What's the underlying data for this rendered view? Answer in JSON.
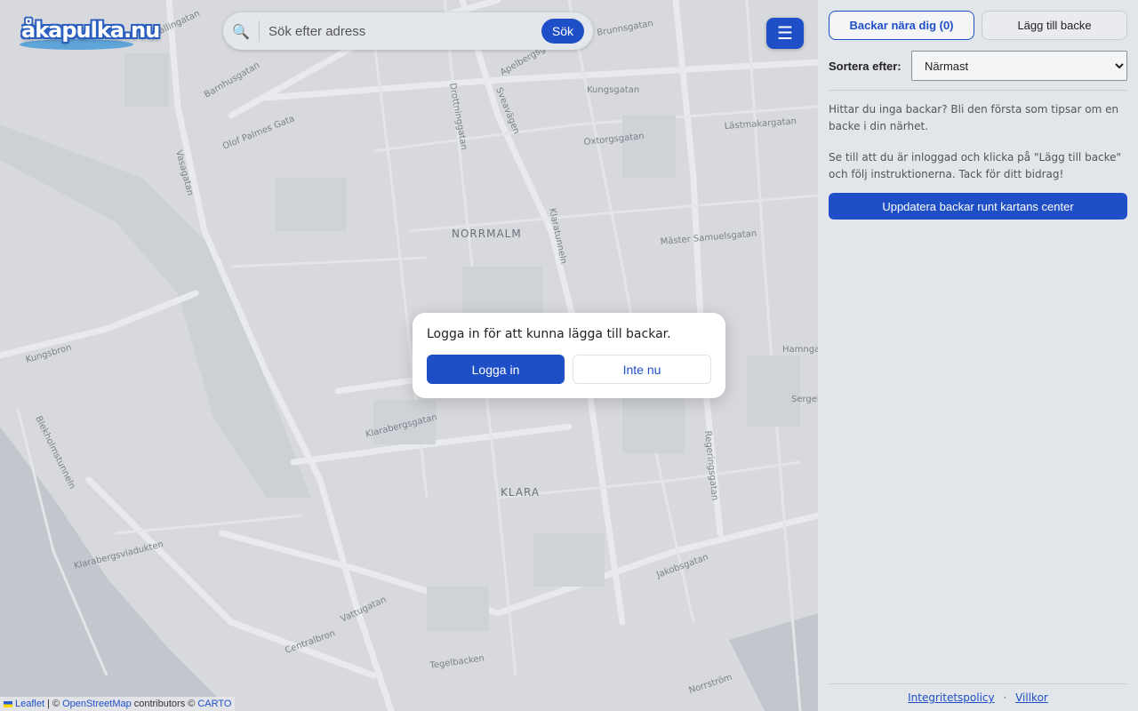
{
  "logo": {
    "text": "åkapulka.nu"
  },
  "search": {
    "placeholder": "Sök efter adress",
    "button_label": "Sök",
    "icon": "search-icon"
  },
  "menu": {
    "icon": "hamburger-icon",
    "glyph": "☰"
  },
  "map": {
    "district_labels": [
      "NORRMALM",
      "KLARA"
    ],
    "street_labels": [
      "Kungsgatan",
      "Olof Palmes Gata",
      "Vasagatan",
      "Sveavägen",
      "Klaratunneln",
      "Apelbergsgatan",
      "Barnhusgatan",
      "Wallingatan",
      "Drottninggatan",
      "Klarabergsgatan",
      "Klarabergsviadukten",
      "Kungsbron",
      "Blekholmstunneln",
      "Centralbron",
      "Vattugatan",
      "Jakobsgatan",
      "Tegelbacken",
      "Regeringsgatan",
      "Mäster Samuelsgatan",
      "Oxtorgsgatan",
      "Lästmakargatan",
      "Brunnsgatan",
      "Norrström",
      "Hamngatan",
      "Sergels torg"
    ]
  },
  "attribution": {
    "leaflet": "Leaflet",
    "sep": "| ©",
    "osm": "OpenStreetMap",
    "contributors": "contributors ©",
    "carto": "CARTO"
  },
  "modal": {
    "message": "Logga in för att kunna lägga till backar.",
    "login_label": "Logga in",
    "not_now_label": "Inte nu"
  },
  "sidebar": {
    "tabs": {
      "near_label": "Backar nära dig (0)",
      "add_label": "Lägg till backe"
    },
    "sort": {
      "label": "Sortera efter:",
      "selected": "Närmast"
    },
    "info_1": "Hittar du inga backar? Bli den första som tipsar om en backe i din närhet.",
    "info_2": "Se till att du är inloggad och klicka på \"Lägg till backe\" och följ instruktionerna. Tack för ditt bidrag!",
    "update_label": "Uppdatera backar runt kartans center",
    "footer": {
      "privacy": "Integritetspolicy",
      "separator": "·",
      "terms": "Villkor"
    }
  },
  "colors": {
    "accent": "#1f4fc7",
    "map_bg": "#d7d9dd",
    "sidebar_bg": "#e2e5e9"
  }
}
